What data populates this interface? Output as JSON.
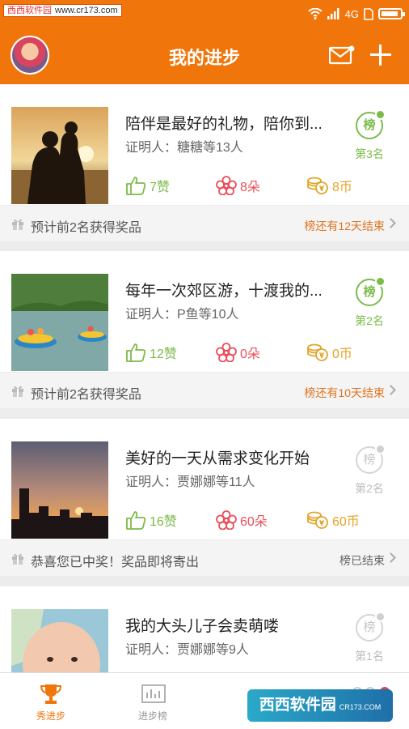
{
  "status_bar": {
    "watermark_site": "西西软件园",
    "watermark_url": "www.cr173.com",
    "network": "4G"
  },
  "header": {
    "title": "我的进步"
  },
  "cards": [
    {
      "title": "陪伴是最好的礼物，陪你到...",
      "witness": "证明人：糖糖等13人",
      "likes": "7赞",
      "flowers": "8朵",
      "coins": "8币",
      "rank_badge": "榜",
      "rank": "第3名",
      "footer_text": "预计前2名获得奖品",
      "footer_status": "榜还有12天结束",
      "finished": false
    },
    {
      "title": "每年一次郊区游，十渡我的...",
      "witness": "证明人：P鱼等10人",
      "likes": "12赞",
      "flowers": "0朵",
      "coins": "0币",
      "rank_badge": "榜",
      "rank": "第2名",
      "footer_text": "预计前2名获得奖品",
      "footer_status": "榜还有10天结束",
      "finished": false
    },
    {
      "title": "美好的一天从需求变化开始",
      "witness": "证明人：贾娜娜等11人",
      "likes": "16赞",
      "flowers": "60朵",
      "coins": "60币",
      "rank_badge": "榜",
      "rank": "第2名",
      "footer_text": "恭喜您已中奖！奖品即将寄出",
      "footer_status": "榜已结束",
      "finished": true
    },
    {
      "title": "我的大头儿子会卖萌喽",
      "witness": "证明人：贾娜娜等9人",
      "rank_badge": "榜",
      "rank": "第1名",
      "finished": true
    }
  ],
  "bottom_nav": [
    {
      "label": "秀进步",
      "active": true
    },
    {
      "label": "进步榜",
      "active": false
    }
  ],
  "watermark_bottom": {
    "text": "西西软件园",
    "url": "CR173.COM"
  },
  "colors": {
    "accent": "#f0760c",
    "green": "#7cbb4a",
    "red": "#ea4f5b",
    "gold": "#e3a52a"
  }
}
